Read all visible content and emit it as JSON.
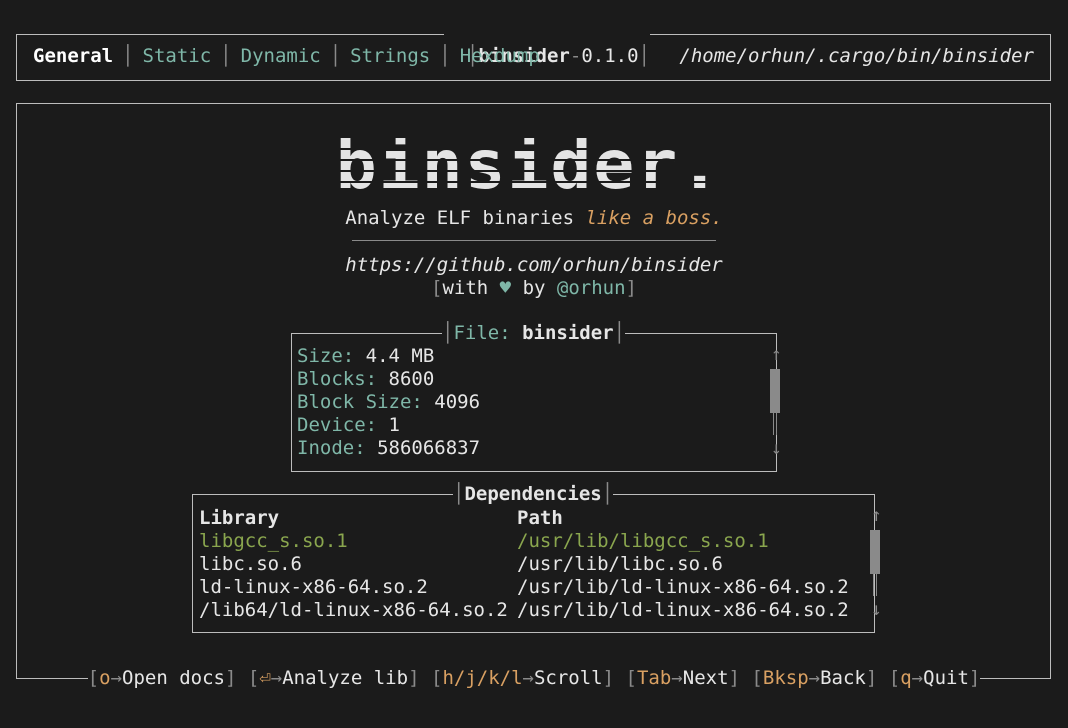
{
  "app": {
    "name": "binsider",
    "version": "0.1.0"
  },
  "tabs": [
    {
      "label": "General",
      "active": true
    },
    {
      "label": "Static",
      "active": false
    },
    {
      "label": "Dynamic",
      "active": false
    },
    {
      "label": "Strings",
      "active": false
    },
    {
      "label": "Hexdump",
      "active": false
    }
  ],
  "path": "/home/orhun/.cargo/bin/binsider",
  "splash": {
    "logo_text": "binsider.",
    "tagline_main": "Analyze ELF binaries ",
    "tagline_accent": "like a boss.",
    "url": "https://github.com/orhun/binsider",
    "credit_with": "with",
    "credit_heart": "♥",
    "credit_by": "by",
    "credit_handle": "@orhun"
  },
  "file_info": {
    "title_label": "File:",
    "title_value": "binsider",
    "rows": [
      {
        "key": "Size:",
        "value": "4.4 MB"
      },
      {
        "key": "Blocks:",
        "value": "8600"
      },
      {
        "key": "Block Size:",
        "value": "4096"
      },
      {
        "key": "Device:",
        "value": "1"
      },
      {
        "key": "Inode:",
        "value": "586066837"
      }
    ]
  },
  "dependencies": {
    "title": "Dependencies",
    "columns": [
      "Library",
      "Path"
    ],
    "rows": [
      {
        "library": "libgcc_s.so.1",
        "path": "/usr/lib/libgcc_s.so.1",
        "selected": true
      },
      {
        "library": "libc.so.6",
        "path": "/usr/lib/libc.so.6",
        "selected": false
      },
      {
        "library": "ld-linux-x86-64.so.2",
        "path": "/usr/lib/ld-linux-x86-64.so.2",
        "selected": false
      },
      {
        "library": "/lib64/ld-linux-x86-64.so.2",
        "path": "/usr/lib/ld-linux-x86-64.so.2",
        "selected": false
      }
    ]
  },
  "keybindings": [
    {
      "key": "o",
      "action": "Open docs"
    },
    {
      "key": "⏎",
      "action": "Analyze lib"
    },
    {
      "key": "h/j/k/l",
      "action": "Scroll"
    },
    {
      "key": "Tab",
      "action": "Next"
    },
    {
      "key": "Bksp",
      "action": "Back"
    },
    {
      "key": "q",
      "action": "Quit"
    }
  ],
  "icons": {
    "arrow": "→",
    "scroll_up": "↑",
    "scroll_down": "↓"
  },
  "colors": {
    "background": "#1b1b1b",
    "accent_teal": "#7fb7a8",
    "accent_orange": "#d9a062",
    "selected_green": "#8aa64e",
    "border": "#bdbdbd"
  }
}
